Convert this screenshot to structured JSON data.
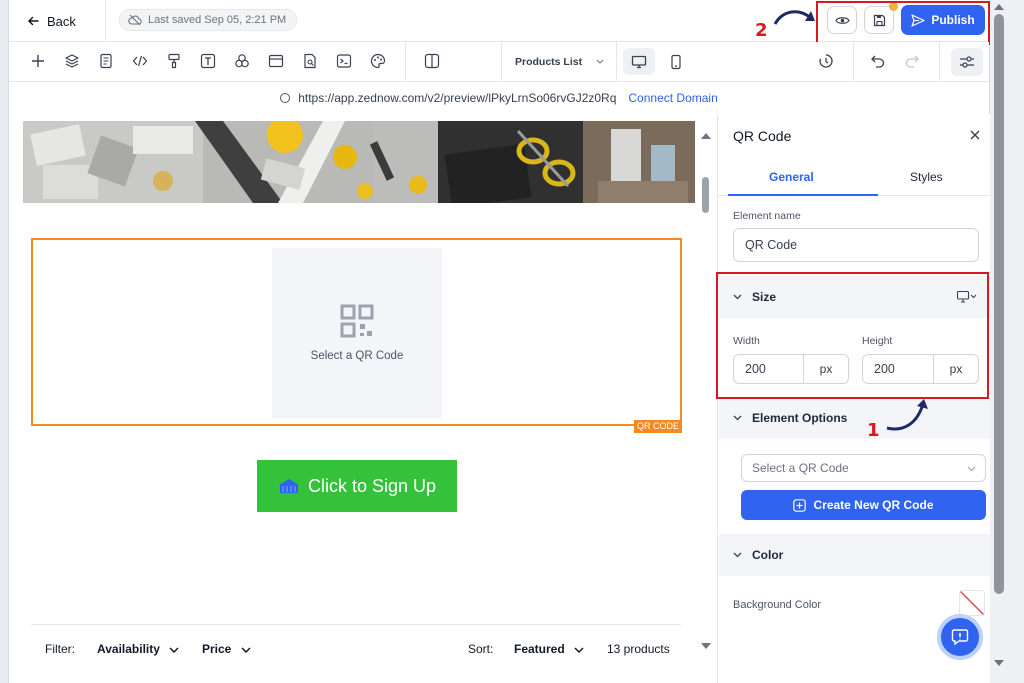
{
  "topbar": {
    "back_label": "Back",
    "last_saved": "Last saved Sep 05, 2:21 PM",
    "publish_label": "Publish"
  },
  "toolbar": {
    "page_select": "Products List"
  },
  "urlbar": {
    "url": "https://app.zednow.com/v2/preview/lPkyLrnSo06rvGJ2z0Rq",
    "connect_label": "Connect Domain"
  },
  "canvas": {
    "qr_placeholder": "Select a QR Code",
    "qr_tag": "QR CODE",
    "signup_label": "Click to Sign Up",
    "filter": {
      "label": "Filter:",
      "availability": "Availability",
      "price": "Price",
      "sort_label": "Sort:",
      "sort_value": "Featured",
      "count": "13 products"
    }
  },
  "panel": {
    "title": "QR Code",
    "tabs": [
      "General",
      "Styles"
    ],
    "element_name_label": "Element name",
    "element_name_value": "QR Code",
    "size_section": "Size",
    "width_label": "Width",
    "width_value": "200",
    "height_label": "Height",
    "height_value": "200",
    "unit": "px",
    "element_options_section": "Element Options",
    "select_placeholder": "Select a QR Code",
    "create_label": "Create New QR Code",
    "color_section": "Color",
    "background_color_label": "Background Color"
  },
  "annotations": {
    "step1": "1",
    "step2": "2"
  },
  "colors": {
    "accent": "#2f63f0",
    "highlight": "#d71920",
    "selection": "#f58a22",
    "cta": "#33c23a"
  }
}
